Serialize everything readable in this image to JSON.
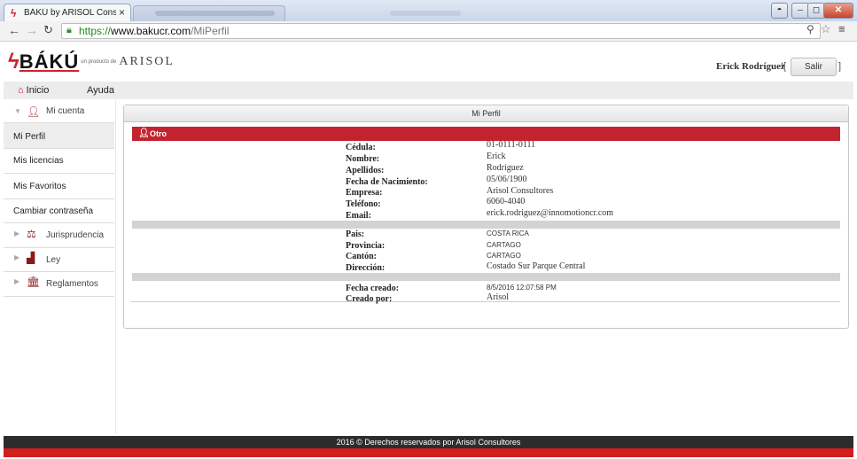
{
  "browser": {
    "tab_title": "BÁKÚ by ARISOL Consulto",
    "tab_close": "×",
    "url_proto": "https://",
    "url_host": "www.bakucr.com",
    "url_path": "/MiPerfil"
  },
  "header": {
    "logo_text": "BÁKÚ",
    "byline": "un producto de",
    "arisol_text": "ARISOL",
    "user_name": "Erick Rodríguez",
    "logout_label": "Salir"
  },
  "menu": {
    "home_label": "Inicio",
    "help_label": "Ayuda"
  },
  "sidebar": {
    "my_account_label": "Mi cuenta",
    "items": [
      {
        "label": "Mi Perfil"
      },
      {
        "label": "Mis licencias"
      },
      {
        "label": "Mis Favoritos"
      },
      {
        "label": "Cambiar contraseña"
      }
    ],
    "groups": [
      {
        "label": "Jurisprudencia",
        "icon": "gavel-icon"
      },
      {
        "label": "Ley",
        "icon": "podium-icon"
      },
      {
        "label": "Reglamentos",
        "icon": "building-icon"
      }
    ]
  },
  "panel": {
    "title": "Mi Perfil",
    "section_title": "Otro",
    "personal": [
      {
        "label": "Cédula:",
        "value": "01-0111-0111"
      },
      {
        "label": "Nombre:",
        "value": "Erick"
      },
      {
        "label": "Apellidos:",
        "value": "Rodríguez"
      },
      {
        "label": "Fecha de Nacimiento:",
        "value": "05/06/1900"
      },
      {
        "label": "Empresa:",
        "value": "Arisol Consultores"
      },
      {
        "label": "Teléfono:",
        "value": "6060-4040"
      },
      {
        "label": "Email:",
        "value": "erick.rodriguez@innomotioncr.com"
      }
    ],
    "location": [
      {
        "label": "Pais:",
        "value": "COSTA RICA"
      },
      {
        "label": "Provincia:",
        "value": "CARTAGO"
      },
      {
        "label": "Cantón:",
        "value": "CARTAGO"
      },
      {
        "label": "Dirección:",
        "value": "Costado Sur Parque Central"
      }
    ],
    "meta": [
      {
        "label": "Fecha creado:",
        "value": "8/5/2016 12:07:58 PM"
      },
      {
        "label": "Creado por:",
        "value": "Arisol"
      }
    ]
  },
  "footer": {
    "text": "2016 © Derechos reservados por Arisol Consultores"
  },
  "colors": {
    "brand_red": "#c3232f",
    "footer_dark": "#2d2d2d"
  }
}
